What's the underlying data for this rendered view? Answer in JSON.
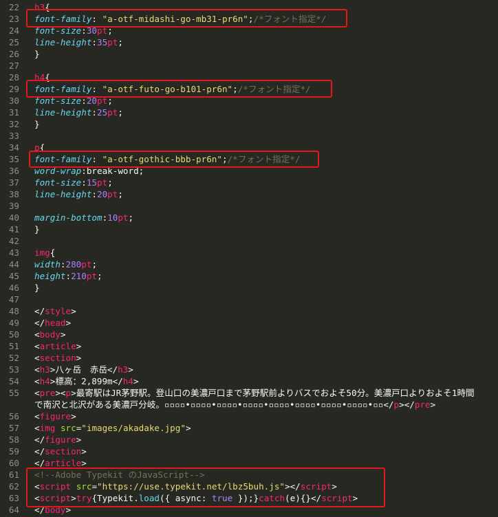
{
  "editor": {
    "lines": [
      {
        "n": "22",
        "tokens": [
          [
            "tag",
            "h3"
          ],
          [
            "plain",
            "{"
          ]
        ]
      },
      {
        "n": "23",
        "tokens": [
          [
            "prop",
            "font-family"
          ],
          [
            "plain",
            ": "
          ],
          [
            "str",
            "\"a-otf-midashi-go-mb31-pr6n\""
          ],
          [
            "plain",
            ";"
          ],
          [
            "cmt",
            "/*フォント指定*/"
          ]
        ]
      },
      {
        "n": "24",
        "tokens": [
          [
            "prop",
            "font-size"
          ],
          [
            "plain",
            ":"
          ],
          [
            "num",
            "30"
          ],
          [
            "unit",
            "pt"
          ],
          [
            "plain",
            ";"
          ]
        ]
      },
      {
        "n": "25",
        "tokens": [
          [
            "prop",
            "line-height"
          ],
          [
            "plain",
            ":"
          ],
          [
            "num",
            "35"
          ],
          [
            "unit",
            "pt"
          ],
          [
            "plain",
            ";"
          ]
        ]
      },
      {
        "n": "26",
        "tokens": [
          [
            "plain",
            "}"
          ]
        ]
      },
      {
        "n": "27",
        "tokens": []
      },
      {
        "n": "28",
        "tokens": [
          [
            "tag",
            "h4"
          ],
          [
            "plain",
            "{"
          ]
        ]
      },
      {
        "n": "29",
        "tokens": [
          [
            "prop",
            "font-family"
          ],
          [
            "plain",
            ": "
          ],
          [
            "str",
            "\"a-otf-futo-go-b101-pr6n\""
          ],
          [
            "plain",
            ";"
          ],
          [
            "cmt",
            "/*フォント指定*/"
          ]
        ]
      },
      {
        "n": "30",
        "tokens": [
          [
            "prop",
            "font-size"
          ],
          [
            "plain",
            ":"
          ],
          [
            "num",
            "20"
          ],
          [
            "unit",
            "pt"
          ],
          [
            "plain",
            ";"
          ]
        ]
      },
      {
        "n": "31",
        "tokens": [
          [
            "prop",
            "line-height"
          ],
          [
            "plain",
            ":"
          ],
          [
            "num",
            "25"
          ],
          [
            "unit",
            "pt"
          ],
          [
            "plain",
            ";"
          ]
        ]
      },
      {
        "n": "32",
        "tokens": [
          [
            "plain",
            "}"
          ]
        ]
      },
      {
        "n": "33",
        "tokens": []
      },
      {
        "n": "34",
        "tokens": [
          [
            "tag",
            "p"
          ],
          [
            "plain",
            "{"
          ]
        ]
      },
      {
        "n": "35",
        "tokens": [
          [
            "prop",
            "font-family"
          ],
          [
            "plain",
            ": "
          ],
          [
            "str",
            "\"a-otf-gothic-bbb-pr6n\""
          ],
          [
            "plain",
            ";"
          ],
          [
            "cmt",
            "/*フォント指定*/"
          ]
        ]
      },
      {
        "n": "36",
        "tokens": [
          [
            "prop",
            "word-wrap"
          ],
          [
            "plain",
            ":break-word;"
          ]
        ]
      },
      {
        "n": "37",
        "tokens": [
          [
            "prop",
            "font-size"
          ],
          [
            "plain",
            ":"
          ],
          [
            "num",
            "15"
          ],
          [
            "unit",
            "pt"
          ],
          [
            "plain",
            ";"
          ]
        ]
      },
      {
        "n": "38",
        "tokens": [
          [
            "prop",
            "line-height"
          ],
          [
            "plain",
            ":"
          ],
          [
            "num",
            "20"
          ],
          [
            "unit",
            "pt"
          ],
          [
            "plain",
            ";"
          ]
        ]
      },
      {
        "n": "39",
        "tokens": []
      },
      {
        "n": "40",
        "tokens": [
          [
            "prop",
            "margin-bottom"
          ],
          [
            "plain",
            ":"
          ],
          [
            "num",
            "10"
          ],
          [
            "unit",
            "pt"
          ],
          [
            "plain",
            ";"
          ]
        ]
      },
      {
        "n": "41",
        "tokens": [
          [
            "plain",
            "}"
          ]
        ]
      },
      {
        "n": "42",
        "tokens": []
      },
      {
        "n": "43",
        "tokens": [
          [
            "tag",
            "img"
          ],
          [
            "plain",
            "{"
          ]
        ]
      },
      {
        "n": "44",
        "tokens": [
          [
            "prop",
            "width"
          ],
          [
            "plain",
            ":"
          ],
          [
            "num",
            "280"
          ],
          [
            "unit",
            "pt"
          ],
          [
            "plain",
            ";"
          ]
        ]
      },
      {
        "n": "45",
        "tokens": [
          [
            "prop",
            "height"
          ],
          [
            "plain",
            ":"
          ],
          [
            "num",
            "210"
          ],
          [
            "unit",
            "pt"
          ],
          [
            "plain",
            ";"
          ]
        ]
      },
      {
        "n": "46",
        "tokens": [
          [
            "plain",
            "}"
          ]
        ]
      },
      {
        "n": "47",
        "tokens": []
      },
      {
        "n": "48",
        "tokens": [
          [
            "plain",
            "</"
          ],
          [
            "tag",
            "style"
          ],
          [
            "plain",
            ">"
          ]
        ]
      },
      {
        "n": "49",
        "tokens": [
          [
            "plain",
            "</"
          ],
          [
            "tag",
            "head"
          ],
          [
            "plain",
            ">"
          ]
        ]
      },
      {
        "n": "50",
        "tokens": [
          [
            "plain",
            "<"
          ],
          [
            "tag",
            "body"
          ],
          [
            "plain",
            ">"
          ]
        ]
      },
      {
        "n": "51",
        "tokens": [
          [
            "plain",
            "<"
          ],
          [
            "tag",
            "article"
          ],
          [
            "plain",
            ">"
          ]
        ]
      },
      {
        "n": "52",
        "tokens": [
          [
            "plain",
            "<"
          ],
          [
            "tag",
            "section"
          ],
          [
            "plain",
            ">"
          ]
        ]
      },
      {
        "n": "53",
        "tokens": [
          [
            "plain",
            "<"
          ],
          [
            "tag",
            "h3"
          ],
          [
            "plain",
            ">八ヶ岳　赤岳</"
          ],
          [
            "tag",
            "h3"
          ],
          [
            "plain",
            ">"
          ]
        ]
      },
      {
        "n": "54",
        "tokens": [
          [
            "plain",
            "<"
          ],
          [
            "tag",
            "h4"
          ],
          [
            "plain",
            ">標高：2,899m</"
          ],
          [
            "tag",
            "h4"
          ],
          [
            "plain",
            ">"
          ]
        ]
      },
      {
        "n": "55",
        "tokens": [
          [
            "plain",
            "<"
          ],
          [
            "tag",
            "pre"
          ],
          [
            "plain",
            "><"
          ],
          [
            "tag",
            "p"
          ],
          [
            "plain",
            ">最寄駅はJR茅野駅。登山口の美濃戸口まで茅野駅前よりバスでおよそ50分。美濃戸口よりおよそ1時間"
          ]
        ],
        "wrap": [
          [
            "plain",
            "で南沢と北沢がある美濃戸分岐。▫▫▫▫•▫▫▫▫•▫▫▫▫•▫▫▫▫•▫▫▫▫•▫▫▫▫•▫▫▫▫•▫▫▫▫•▫▫</"
          ],
          [
            "tag",
            "p"
          ],
          [
            "plain",
            "></"
          ],
          [
            "tag",
            "pre"
          ],
          [
            "plain",
            ">"
          ]
        ]
      },
      {
        "n": "56",
        "tokens": [
          [
            "plain",
            "<"
          ],
          [
            "tag",
            "figure"
          ],
          [
            "plain",
            ">"
          ]
        ]
      },
      {
        "n": "57",
        "tokens": [
          [
            "plain",
            "<"
          ],
          [
            "tag",
            "img"
          ],
          [
            "plain",
            " "
          ],
          [
            "attr",
            "src"
          ],
          [
            "plain",
            "="
          ],
          [
            "str",
            "\"images/akadake.jpg\""
          ],
          [
            "plain",
            ">"
          ]
        ]
      },
      {
        "n": "58",
        "tokens": [
          [
            "plain",
            "</"
          ],
          [
            "tag",
            "figure"
          ],
          [
            "plain",
            ">"
          ]
        ]
      },
      {
        "n": "59",
        "tokens": [
          [
            "plain",
            "</"
          ],
          [
            "tag",
            "section"
          ],
          [
            "plain",
            ">"
          ]
        ]
      },
      {
        "n": "60",
        "tokens": [
          [
            "plain",
            "</"
          ],
          [
            "tag",
            "article"
          ],
          [
            "plain",
            ">"
          ]
        ]
      },
      {
        "n": "61",
        "tokens": [
          [
            "cmt",
            "<!--Adobe Typekit のJavaScript-->"
          ]
        ]
      },
      {
        "n": "62",
        "tokens": [
          [
            "plain",
            "<"
          ],
          [
            "tag",
            "script"
          ],
          [
            "plain",
            " "
          ],
          [
            "attr",
            "src"
          ],
          [
            "plain",
            "="
          ],
          [
            "str",
            "\"https://use.typekit.net/lbz5buh.js\""
          ],
          [
            "plain",
            "></"
          ],
          [
            "tag",
            "script"
          ],
          [
            "plain",
            ">"
          ]
        ]
      },
      {
        "n": "63",
        "tokens": [
          [
            "plain",
            "<"
          ],
          [
            "tag",
            "script"
          ],
          [
            "plain",
            ">"
          ],
          [
            "kw",
            "try"
          ],
          [
            "plain",
            "{Typekit."
          ],
          [
            "fn",
            "load"
          ],
          [
            "plain",
            "({ async: "
          ],
          [
            "const",
            "true"
          ],
          [
            "plain",
            " });}"
          ],
          [
            "kw",
            "catch"
          ],
          [
            "plain",
            "(e){}</"
          ],
          [
            "tag",
            "script"
          ],
          [
            "plain",
            ">"
          ]
        ]
      },
      {
        "n": "64",
        "tokens": [
          [
            "plain",
            "</"
          ],
          [
            "tag",
            "body"
          ],
          [
            "plain",
            ">"
          ]
        ]
      }
    ]
  }
}
